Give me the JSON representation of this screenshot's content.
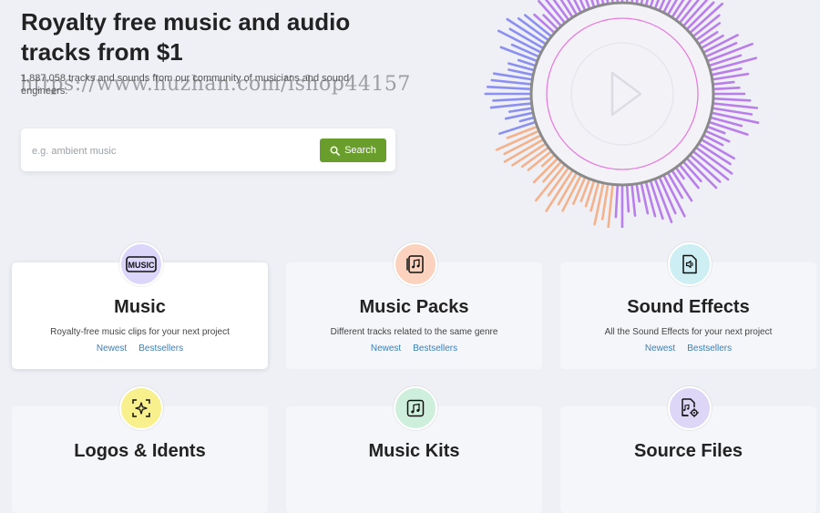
{
  "hero": {
    "title": "Royalty free music and audio tracks from $1",
    "subtitle": "1,837,058 tracks and sounds from our community of musicians and sound engineers.",
    "watermark": "https://www.huzhan.com/ishop44157"
  },
  "search": {
    "placeholder": "e.g. ambient music",
    "button_label": "Search",
    "button_color": "#6a9e2c"
  },
  "categories": [
    {
      "title": "Music",
      "description": "Royalty-free music clips for your next project",
      "link_newest": "Newest",
      "link_bestsellers": "Bestsellers",
      "icon": "music-label-icon",
      "icon_bg": "#dcd6fb"
    },
    {
      "title": "Music Packs",
      "description": "Different tracks related to the same genre",
      "link_newest": "Newest",
      "link_bestsellers": "Bestsellers",
      "icon": "music-pack-icon",
      "icon_bg": "#fbd2bd"
    },
    {
      "title": "Sound Effects",
      "description": "All the Sound Effects for your next project",
      "link_newest": "Newest",
      "link_bestsellers": "Bestsellers",
      "icon": "sound-file-icon",
      "icon_bg": "#cdeef2"
    },
    {
      "title": "Logos & Idents",
      "icon": "sparkle-icon",
      "icon_bg": "#f8f08c"
    },
    {
      "title": "Music Kits",
      "icon": "music-kit-icon",
      "icon_bg": "#cdefdc"
    },
    {
      "title": "Source Files",
      "icon": "source-file-icon",
      "icon_bg": "#ddd6f7"
    }
  ],
  "colors": {
    "page_background": "#eef0f5",
    "link": "#3b7fb6",
    "wave_purple": "#b06be8",
    "wave_orange": "#f5a77a",
    "wave_blue": "#7a7ff0"
  }
}
